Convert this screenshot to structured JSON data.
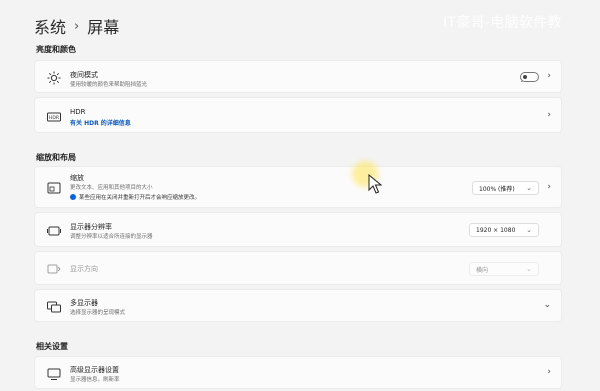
{
  "watermark": "IT豪哥-电脑软件教",
  "breadcrumb": {
    "parent": "系统",
    "separator": "›",
    "current": "屏幕"
  },
  "sections": {
    "brightness": "亮度和颜色",
    "scale_layout": "缩放和布局",
    "related": "相关设置"
  },
  "night_light": {
    "title": "夜间模式",
    "desc": "使用较暖的颜色来帮助阻挡蓝光",
    "toggle_label": "关",
    "icon": "sun-icon"
  },
  "hdr": {
    "title": "HDR",
    "link": "有关 HDR 的详细信息",
    "icon": "hdr-icon"
  },
  "scale": {
    "title": "缩放",
    "desc": "更改文本、应用和其他项目的大小",
    "warning": "某些应用在关闭并重新打开后才会响应缩放更改。",
    "value": "100% (推荐)",
    "icon": "scale-icon"
  },
  "resolution": {
    "title": "显示器分辨率",
    "desc": "调整分辨率以适合所连接的显示器",
    "value": "1920 × 1080",
    "icon": "resolution-icon"
  },
  "orientation": {
    "title": "显示方向",
    "value": "横向",
    "icon": "orientation-icon"
  },
  "multi_display": {
    "title": "多显示器",
    "desc": "选择显示器的呈现模式",
    "icon": "multi-display-icon"
  },
  "advanced_display": {
    "title": "高级显示器设置",
    "desc": "显示器信息，刷新率",
    "icon": "monitor-icon"
  },
  "colors": {
    "background": "#f3f3f3",
    "card": "#fbfbfb",
    "accent": "#0a59b8",
    "cursor_highlight": "#ffe650"
  }
}
